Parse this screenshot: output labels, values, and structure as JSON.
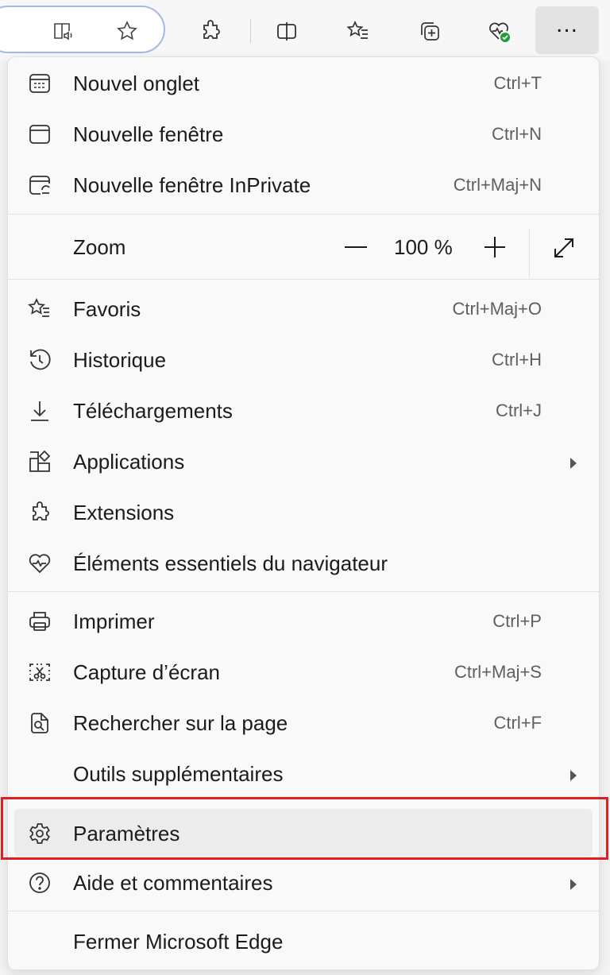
{
  "toolbar": {
    "icons": [
      "read-aloud-icon",
      "favorite-star-icon",
      "extensions-icon",
      "split-screen-icon",
      "favorites-icon",
      "collections-icon",
      "browser-essentials-icon",
      "more-icon"
    ]
  },
  "menu": {
    "new_tab": {
      "label": "Nouvel onglet",
      "shortcut": "Ctrl+T"
    },
    "new_window": {
      "label": "Nouvelle fenêtre",
      "shortcut": "Ctrl+N"
    },
    "inprivate": {
      "label": "Nouvelle fenêtre InPrivate",
      "shortcut": "Ctrl+Maj+N"
    },
    "zoom": {
      "label": "Zoom",
      "value": "100 %"
    },
    "favorites": {
      "label": "Favoris",
      "shortcut": "Ctrl+Maj+O"
    },
    "history": {
      "label": "Historique",
      "shortcut": "Ctrl+H"
    },
    "downloads": {
      "label": "Téléchargements",
      "shortcut": "Ctrl+J"
    },
    "apps": {
      "label": "Applications"
    },
    "extensions": {
      "label": "Extensions"
    },
    "essentials": {
      "label": "Éléments essentiels du navigateur"
    },
    "print": {
      "label": "Imprimer",
      "shortcut": "Ctrl+P"
    },
    "screenshot": {
      "label": "Capture d’écran",
      "shortcut": "Ctrl+Maj+S"
    },
    "find": {
      "label": "Rechercher sur la page",
      "shortcut": "Ctrl+F"
    },
    "more_tools": {
      "label": "Outils supplémentaires"
    },
    "settings": {
      "label": "Paramètres"
    },
    "help": {
      "label": "Aide et commentaires"
    },
    "close": {
      "label": "Fermer Microsoft Edge"
    }
  },
  "colors": {
    "highlight_border": "#e02020",
    "menu_bg": "#f9f9f9",
    "hover_bg": "#ececec"
  }
}
